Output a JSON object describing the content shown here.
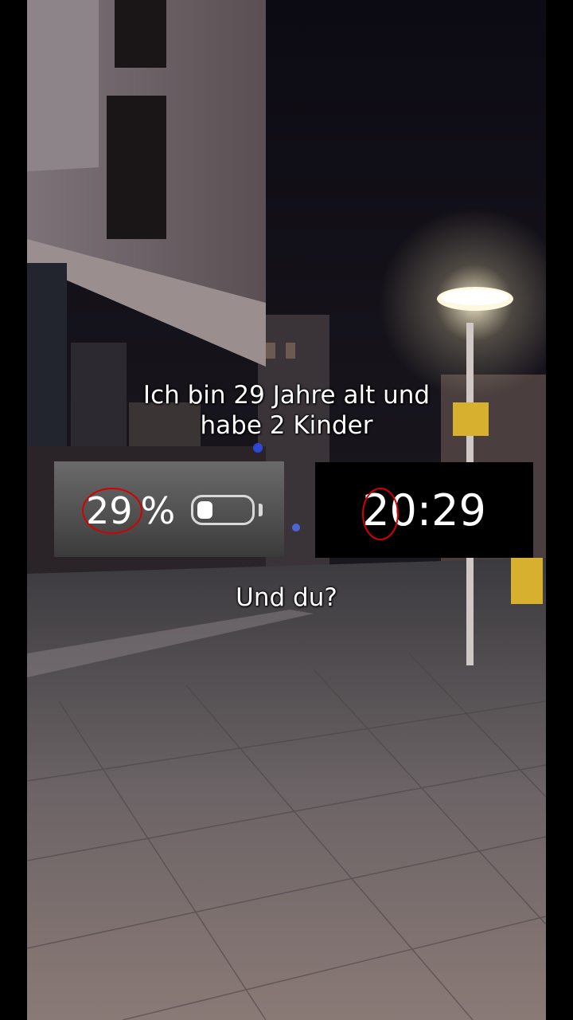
{
  "caption": {
    "line1": "Ich bin 29 Jahre alt und",
    "line2": "habe 2 Kinder",
    "question": "Und du?"
  },
  "battery": {
    "percent_number": "29",
    "percent_sign": "%",
    "level": 0.29
  },
  "clock": {
    "time": "20:29"
  },
  "colors": {
    "highlight_ring": "#d40000",
    "lamp_glow": "#fff6d8"
  }
}
